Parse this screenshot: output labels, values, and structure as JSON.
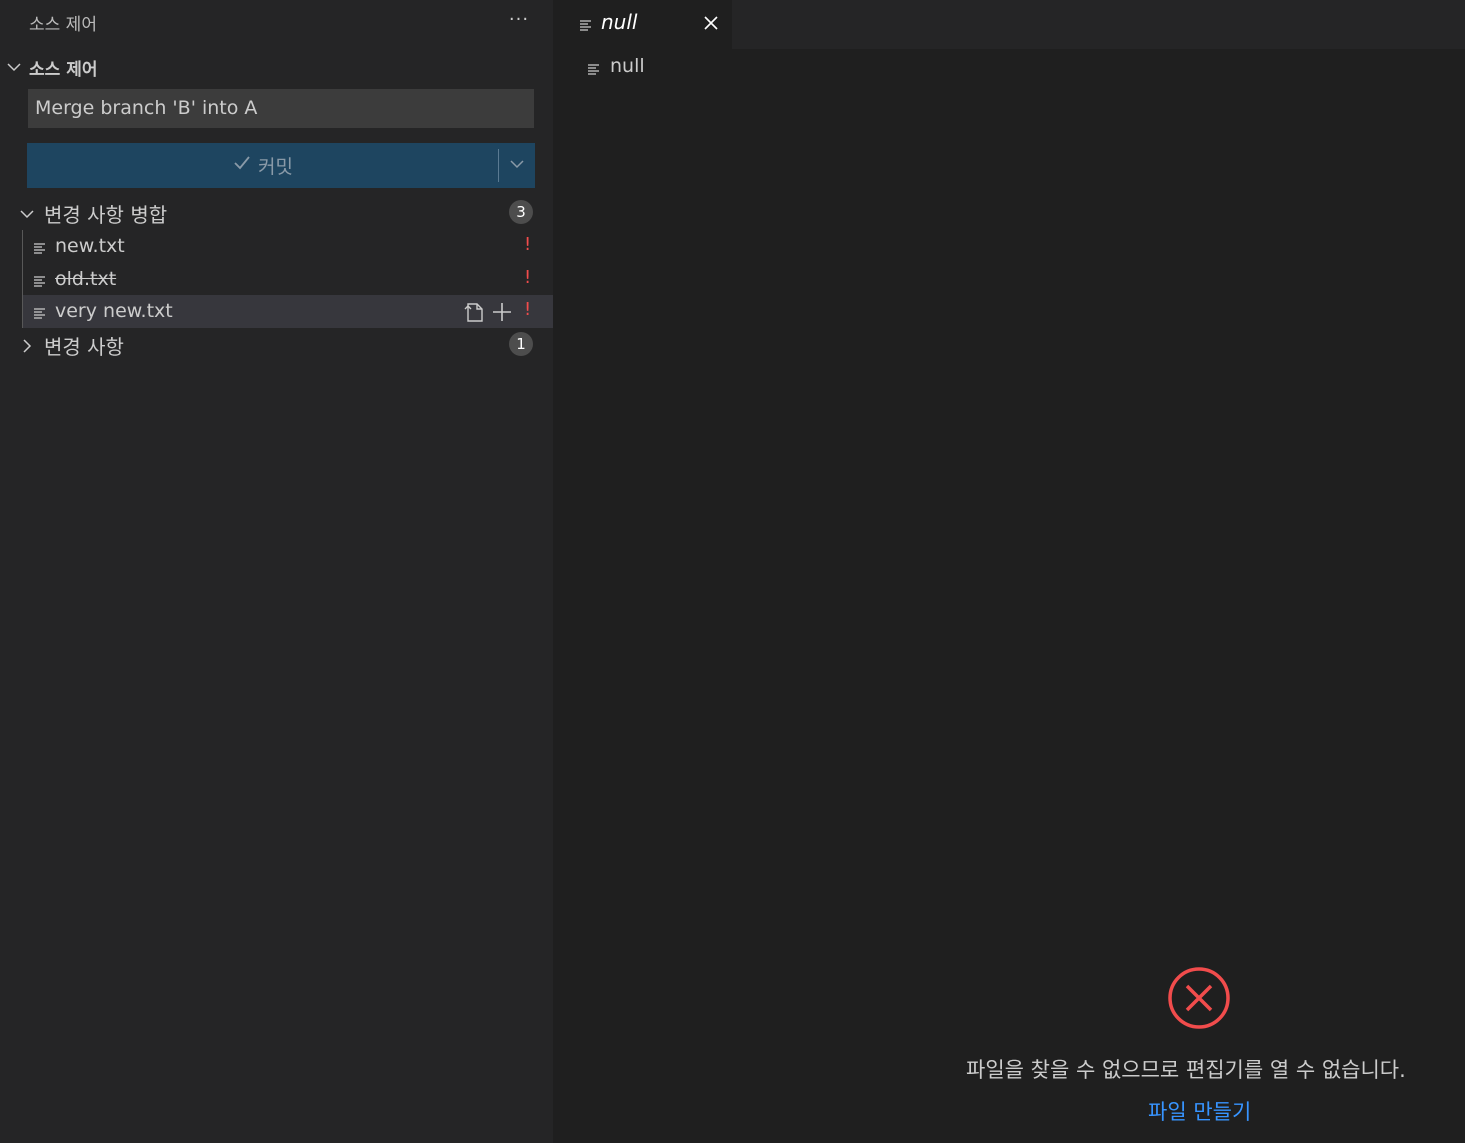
{
  "sidebar": {
    "title": "소스 제어",
    "more_label": "···",
    "section_label": "소스 제어",
    "commit_message": "Merge branch 'B' into A",
    "commit_button_label": "커밋",
    "groups": [
      {
        "label": "변경 사항 병합",
        "count": "3",
        "expanded": true,
        "files": [
          {
            "name": "new.txt",
            "status": "!",
            "deleted": false
          },
          {
            "name": "old.txt",
            "status": "!",
            "deleted": true
          },
          {
            "name": "very new.txt",
            "status": "!",
            "deleted": false,
            "selected": true
          }
        ]
      },
      {
        "label": "변경 사항",
        "count": "1",
        "expanded": false
      }
    ]
  },
  "editor": {
    "tab_label": "null",
    "breadcrumb": "null",
    "error_message": "파일을 찾을 수 없으므로 편집기를 열 수 없습니다.",
    "create_file_link": "파일 만들기"
  },
  "colors": {
    "accent_link": "#3794ff",
    "error": "#f14c4c",
    "commit_button": "#1e4560"
  }
}
